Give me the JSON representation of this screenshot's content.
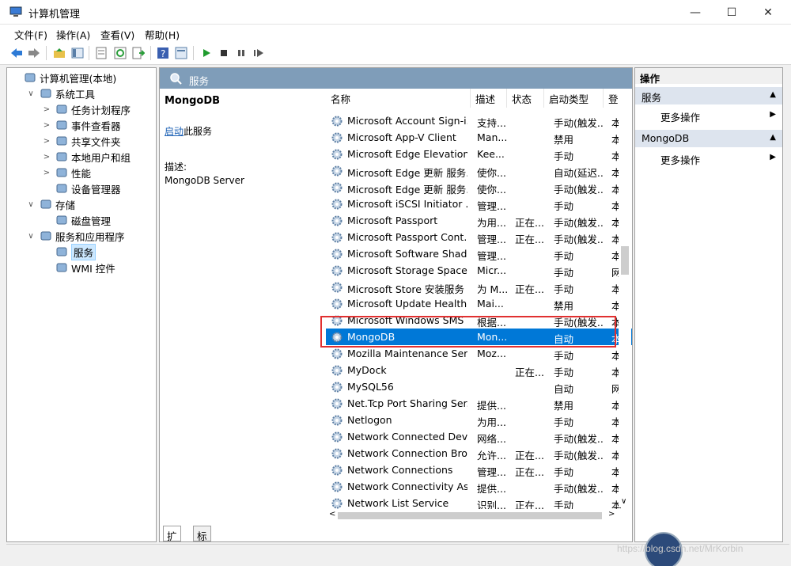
{
  "window": {
    "title": "计算机管理",
    "min": "—",
    "max": "☐",
    "close": "✕"
  },
  "menu": [
    "文件(F)",
    "操作(A)",
    "查看(V)",
    "帮助(H)"
  ],
  "tree": [
    {
      "label": "计算机管理(本地)",
      "depth": 0,
      "twisty": "",
      "icon": "computer-icon"
    },
    {
      "label": "系统工具",
      "depth": 1,
      "twisty": "∨",
      "icon": "tools-icon"
    },
    {
      "label": "任务计划程序",
      "depth": 2,
      "twisty": ">",
      "icon": "clock-icon"
    },
    {
      "label": "事件查看器",
      "depth": 2,
      "twisty": ">",
      "icon": "event-icon"
    },
    {
      "label": "共享文件夹",
      "depth": 2,
      "twisty": ">",
      "icon": "folder-icon"
    },
    {
      "label": "本地用户和组",
      "depth": 2,
      "twisty": ">",
      "icon": "users-icon"
    },
    {
      "label": "性能",
      "depth": 2,
      "twisty": ">",
      "icon": "performance-icon"
    },
    {
      "label": "设备管理器",
      "depth": 2,
      "twisty": "",
      "icon": "device-icon"
    },
    {
      "label": "存储",
      "depth": 1,
      "twisty": "∨",
      "icon": "storage-icon"
    },
    {
      "label": "磁盘管理",
      "depth": 2,
      "twisty": "",
      "icon": "disk-icon"
    },
    {
      "label": "服务和应用程序",
      "depth": 1,
      "twisty": "∨",
      "icon": "apps-icon"
    },
    {
      "label": "服务",
      "depth": 2,
      "twisty": "",
      "icon": "gear-icon",
      "selected": true
    },
    {
      "label": "WMI 控件",
      "depth": 2,
      "twisty": "",
      "icon": "wmi-icon"
    }
  ],
  "center": {
    "header": "服务",
    "selected_name": "MongoDB",
    "start_link": "启动",
    "start_suffix": "此服务",
    "desc_label": "描述:",
    "desc_text": "MongoDB Server"
  },
  "columns": [
    "名称",
    "描述",
    "状态",
    "启动类型",
    "登"
  ],
  "rows": [
    {
      "name": "Microsoft Account Sign-i...",
      "desc": "支持...",
      "status": "",
      "startup": "手动(触发...",
      "logon": "本"
    },
    {
      "name": "Microsoft App-V Client",
      "desc": "Man...",
      "status": "",
      "startup": "禁用",
      "logon": "本"
    },
    {
      "name": "Microsoft Edge Elevation...",
      "desc": "Kee...",
      "status": "",
      "startup": "手动",
      "logon": "本"
    },
    {
      "name": "Microsoft Edge 更新 服务...",
      "desc": "使你...",
      "status": "",
      "startup": "自动(延迟...",
      "logon": "本"
    },
    {
      "name": "Microsoft Edge 更新 服务...",
      "desc": "使你...",
      "status": "",
      "startup": "手动(触发...",
      "logon": "本"
    },
    {
      "name": "Microsoft iSCSI Initiator ...",
      "desc": "管理...",
      "status": "",
      "startup": "手动",
      "logon": "本"
    },
    {
      "name": "Microsoft Passport",
      "desc": "为用...",
      "status": "正在...",
      "startup": "手动(触发...",
      "logon": "本"
    },
    {
      "name": "Microsoft Passport Cont...",
      "desc": "管理...",
      "status": "正在...",
      "startup": "手动(触发...",
      "logon": "本"
    },
    {
      "name": "Microsoft Software Shad...",
      "desc": "管理...",
      "status": "",
      "startup": "手动",
      "logon": "本"
    },
    {
      "name": "Microsoft Storage Space...",
      "desc": "Micr...",
      "status": "",
      "startup": "手动",
      "logon": "网"
    },
    {
      "name": "Microsoft Store 安装服务",
      "desc": "为 M...",
      "status": "正在...",
      "startup": "手动",
      "logon": "本"
    },
    {
      "name": "Microsoft Update Health...",
      "desc": "Mai...",
      "status": "",
      "startup": "禁用",
      "logon": "本"
    },
    {
      "name": "Microsoft Windows SMS ...",
      "desc": "根据...",
      "status": "",
      "startup": "手动(触发...",
      "logon": "本"
    },
    {
      "name": "MongoDB",
      "desc": "Mon...",
      "status": "",
      "startup": "自动",
      "logon": "本",
      "selected": true
    },
    {
      "name": "Mozilla Maintenance Ser...",
      "desc": "Moz...",
      "status": "",
      "startup": "手动",
      "logon": "本"
    },
    {
      "name": "MyDock",
      "desc": "",
      "status": "正在...",
      "startup": "手动",
      "logon": "本"
    },
    {
      "name": "MySQL56",
      "desc": "",
      "status": "",
      "startup": "自动",
      "logon": "网"
    },
    {
      "name": "Net.Tcp Port Sharing Ser...",
      "desc": "提供...",
      "status": "",
      "startup": "禁用",
      "logon": "本"
    },
    {
      "name": "Netlogon",
      "desc": "为用...",
      "status": "",
      "startup": "手动",
      "logon": "本"
    },
    {
      "name": "Network Connected Devi...",
      "desc": "网络...",
      "status": "",
      "startup": "手动(触发...",
      "logon": "本"
    },
    {
      "name": "Network Connection Bro...",
      "desc": "允许...",
      "status": "正在...",
      "startup": "手动(触发...",
      "logon": "本"
    },
    {
      "name": "Network Connections",
      "desc": "管理...",
      "status": "正在...",
      "startup": "手动",
      "logon": "本"
    },
    {
      "name": "Network Connectivity Ass...",
      "desc": "提供...",
      "status": "",
      "startup": "手动(触发...",
      "logon": "本"
    },
    {
      "name": "Network List Service",
      "desc": "识别...",
      "status": "正在...",
      "startup": "手动",
      "logon": "本"
    }
  ],
  "tabs": [
    "扩展",
    "标准"
  ],
  "actions": {
    "header": "操作",
    "groups": [
      {
        "title": "服务",
        "item": "更多操作"
      },
      {
        "title": "MongoDB",
        "item": "更多操作"
      }
    ]
  },
  "watermark": "https://blog.csdn.net/MrKorbin"
}
